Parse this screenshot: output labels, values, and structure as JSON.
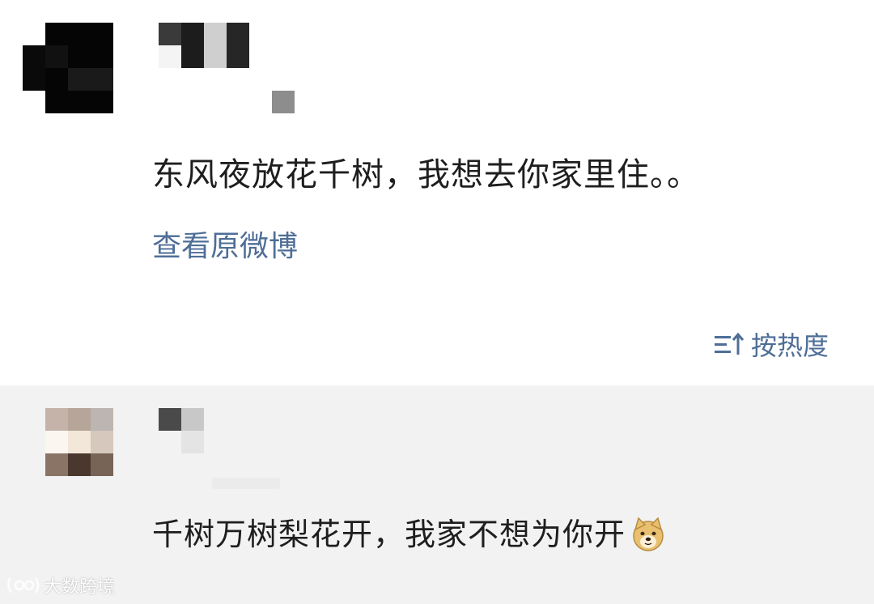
{
  "post": {
    "text": "东风夜放花千树，我想去你家里住。。",
    "view_original_label": "查看原微博"
  },
  "sort": {
    "label": "按热度",
    "icon": "sort-icon"
  },
  "comment": {
    "text": "千树万树梨花开，我家不想为你开",
    "emoji": "doge-emoji"
  },
  "watermark": {
    "text": "大数跨境"
  },
  "colors": {
    "link": "#4e6e97",
    "comment_bg": "#f2f2f2",
    "text": "#1e1e1e"
  }
}
